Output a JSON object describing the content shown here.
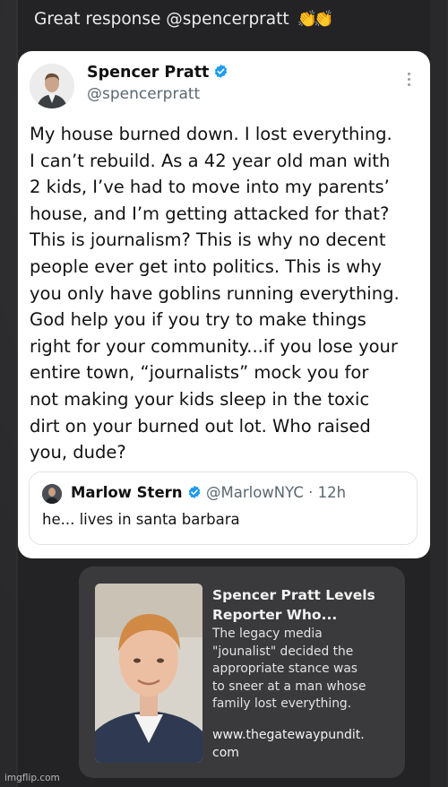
{
  "caption": {
    "text": "Great response @spencerpratt",
    "emoji": "👏👏"
  },
  "tweet": {
    "author_name": "Spencer Pratt",
    "author_handle": "@spencerpratt",
    "verified_color": "#1d9bf0",
    "body_lines": [
      "My house burned down. I lost everything.",
      "I can’t rebuild. As a 42 year old man with",
      "2 kids, I’ve had to move into my parents’",
      "house, and I’m getting attacked for that?",
      "This is journalism? This is why no decent",
      "people ever get into politics. This is why",
      "you only have goblins running everything.",
      "God help you if you try to make things",
      "right for your community...if you lose your",
      "entire town, “journalists” mock you for",
      "not making your kids sleep in the toxic",
      "dirt on your burned out lot. Who raised",
      "you, dude?"
    ],
    "quoted": {
      "author_name": "Marlow Stern",
      "author_handle": "@MarlowNYC · 12h",
      "text": "he... lives in santa barbara"
    }
  },
  "link_card": {
    "title_lines": [
      "Spencer Pratt Levels",
      "Reporter Who..."
    ],
    "description_lines": [
      "The legacy media",
      "\"jounalist\" decided the",
      "appropriate stance was",
      "to sneer at a man whose",
      "family lost everything."
    ],
    "url_lines": [
      "www.thegatewaypundit.",
      "com"
    ]
  },
  "watermark": "imgflip.com"
}
